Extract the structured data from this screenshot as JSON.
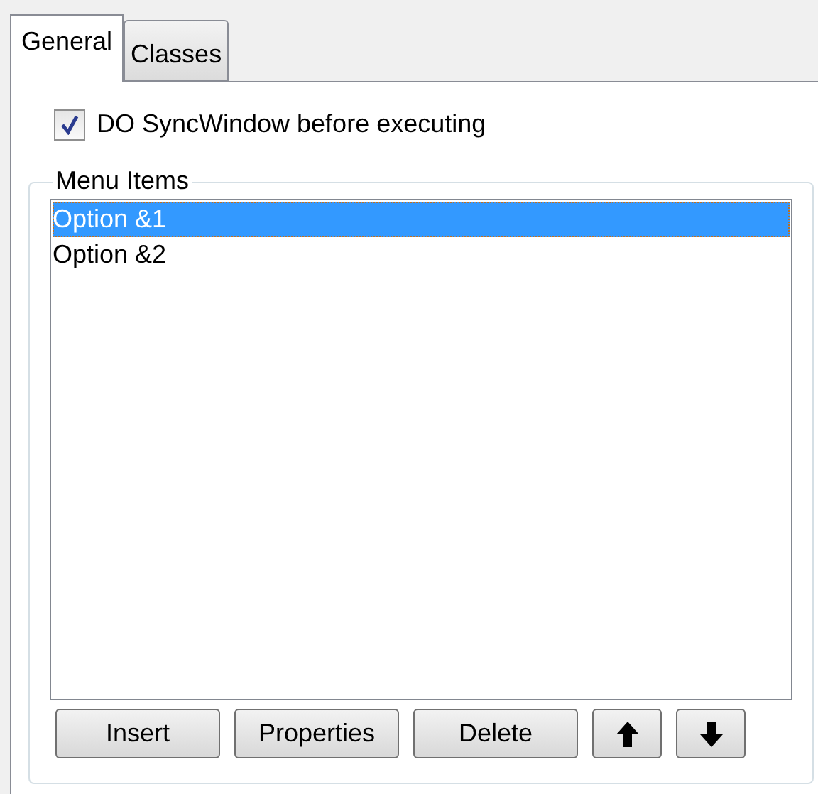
{
  "tabs": [
    {
      "label": "General",
      "selected": true
    },
    {
      "label": "Classes",
      "selected": false
    }
  ],
  "sync_checkbox": {
    "label": "DO SyncWindow before executing",
    "checked": true
  },
  "menu_items": {
    "title": "Menu Items",
    "items": [
      {
        "label": "Option &1",
        "selected": true
      },
      {
        "label": "Option &2",
        "selected": false
      }
    ]
  },
  "buttons": [
    {
      "kind": "text",
      "label": "Insert"
    },
    {
      "kind": "text",
      "label": "Properties"
    },
    {
      "kind": "text",
      "label": "Delete"
    },
    {
      "kind": "up"
    },
    {
      "kind": "down"
    }
  ]
}
